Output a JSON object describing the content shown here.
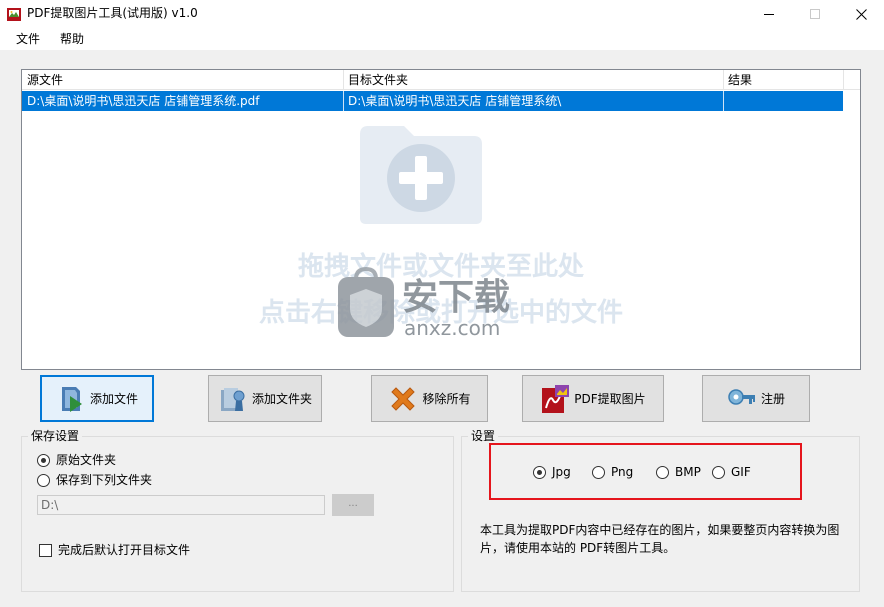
{
  "window": {
    "title": "PDF提取图片工具(试用版) v1.0"
  },
  "menu": {
    "file": "文件",
    "help": "帮助"
  },
  "file_list": {
    "columns": [
      "源文件",
      "目标文件夹",
      "结果"
    ],
    "rows": [
      {
        "source": "D:\\桌面\\说明书\\思迅天店 店铺管理系统.pdf",
        "target": "D:\\桌面\\说明书\\思迅天店 店铺管理系统\\",
        "result": ""
      }
    ],
    "hint_line1": "拖拽文件或文件夹至此处",
    "hint_line2": "点击右键移除或打开选中的文件",
    "watermark_brand": "安下载",
    "watermark_domain": "anxz.com"
  },
  "buttons": {
    "add_file": "添加文件",
    "add_folder": "添加文件夹",
    "remove_all": "移除所有",
    "extract": "PDF提取图片",
    "register": "注册"
  },
  "save_settings": {
    "title": "保存设置",
    "option_original": "原始文件夹",
    "option_custom": "保存到下列文件夹",
    "selected": "original",
    "path_value": "D:\\",
    "browse_label": "...",
    "open_after": "完成后默认打开目标文件",
    "open_after_checked": false
  },
  "settings": {
    "title": "设置",
    "formats": [
      "Jpg",
      "Png",
      "BMP",
      "GIF"
    ],
    "selected_format": "Jpg",
    "note": "本工具为提取PDF内容中已经存在的图片，如果要整页内容转换为图片，请使用本站的 PDF转图片工具。"
  },
  "colors": {
    "selection": "#0078d7",
    "highlight_box": "#e5151c",
    "watermark": "#dbe5ef"
  },
  "icons": {
    "app": "pdf-tool-icon",
    "add_file": "add-file-icon",
    "add_folder": "add-folder-icon",
    "remove_all": "remove-x-icon",
    "extract": "pdf-extract-icon",
    "register": "key-icon"
  }
}
